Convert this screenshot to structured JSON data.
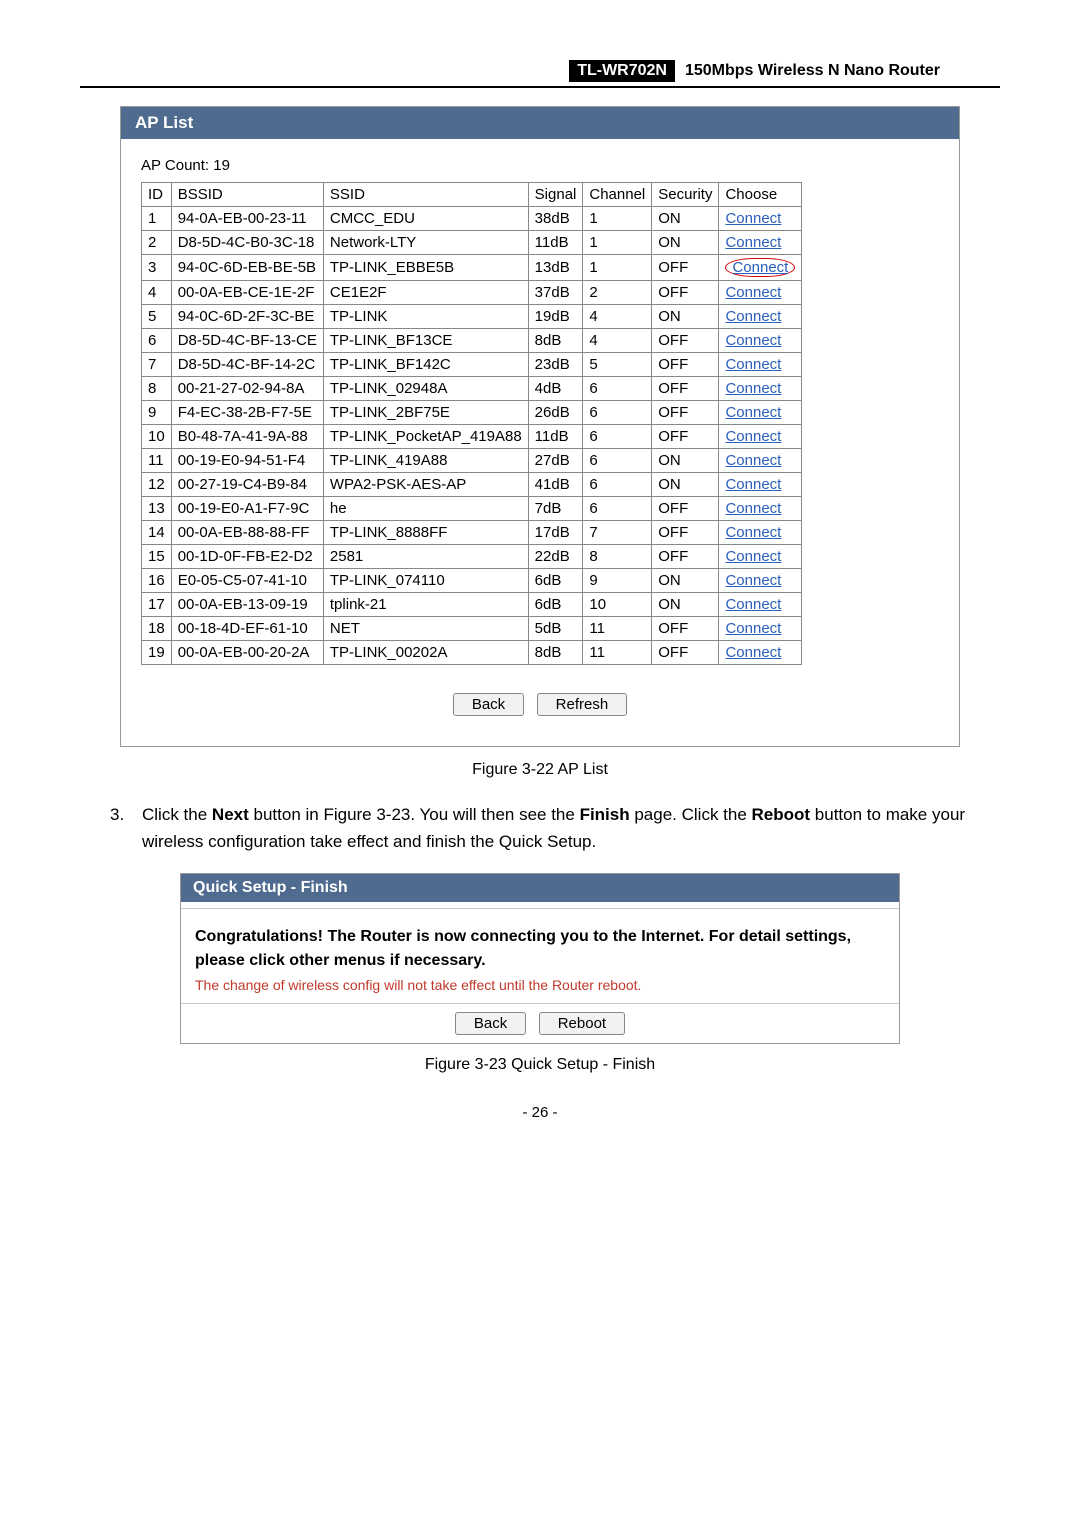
{
  "header": {
    "model": "TL-WR702N",
    "product": "150Mbps Wireless N Nano Router"
  },
  "ap_panel": {
    "title": "AP List",
    "count_label": "AP Count:   19",
    "columns": [
      "ID",
      "BSSID",
      "SSID",
      "Signal",
      "Channel",
      "Security",
      "Choose"
    ],
    "connect_label": "Connect",
    "rows": [
      {
        "id": "1",
        "bssid": "94-0A-EB-00-23-11",
        "ssid": "CMCC_EDU",
        "signal": "38dB",
        "channel": "1",
        "security": "ON",
        "highlight": false
      },
      {
        "id": "2",
        "bssid": "D8-5D-4C-B0-3C-18",
        "ssid": "Network-LTY",
        "signal": "11dB",
        "channel": "1",
        "security": "ON",
        "highlight": false
      },
      {
        "id": "3",
        "bssid": "94-0C-6D-EB-BE-5B",
        "ssid": "TP-LINK_EBBE5B",
        "signal": "13dB",
        "channel": "1",
        "security": "OFF",
        "highlight": true
      },
      {
        "id": "4",
        "bssid": "00-0A-EB-CE-1E-2F",
        "ssid": "CE1E2F",
        "signal": "37dB",
        "channel": "2",
        "security": "OFF",
        "highlight": false
      },
      {
        "id": "5",
        "bssid": "94-0C-6D-2F-3C-BE",
        "ssid": "TP-LINK",
        "signal": "19dB",
        "channel": "4",
        "security": "ON",
        "highlight": false
      },
      {
        "id": "6",
        "bssid": "D8-5D-4C-BF-13-CE",
        "ssid": "TP-LINK_BF13CE",
        "signal": "8dB",
        "channel": "4",
        "security": "OFF",
        "highlight": false
      },
      {
        "id": "7",
        "bssid": "D8-5D-4C-BF-14-2C",
        "ssid": "TP-LINK_BF142C",
        "signal": "23dB",
        "channel": "5",
        "security": "OFF",
        "highlight": false
      },
      {
        "id": "8",
        "bssid": "00-21-27-02-94-8A",
        "ssid": "TP-LINK_02948A",
        "signal": "4dB",
        "channel": "6",
        "security": "OFF",
        "highlight": false
      },
      {
        "id": "9",
        "bssid": "F4-EC-38-2B-F7-5E",
        "ssid": "TP-LINK_2BF75E",
        "signal": "26dB",
        "channel": "6",
        "security": "OFF",
        "highlight": false
      },
      {
        "id": "10",
        "bssid": "B0-48-7A-41-9A-88",
        "ssid": "TP-LINK_PocketAP_419A88",
        "signal": "11dB",
        "channel": "6",
        "security": "OFF",
        "highlight": false
      },
      {
        "id": "11",
        "bssid": "00-19-E0-94-51-F4",
        "ssid": "TP-LINK_419A88",
        "signal": "27dB",
        "channel": "6",
        "security": "ON",
        "highlight": false
      },
      {
        "id": "12",
        "bssid": "00-27-19-C4-B9-84",
        "ssid": "WPA2-PSK-AES-AP",
        "signal": "41dB",
        "channel": "6",
        "security": "ON",
        "highlight": false
      },
      {
        "id": "13",
        "bssid": "00-19-E0-A1-F7-9C",
        "ssid": "he",
        "signal": "7dB",
        "channel": "6",
        "security": "OFF",
        "highlight": false
      },
      {
        "id": "14",
        "bssid": "00-0A-EB-88-88-FF",
        "ssid": "TP-LINK_8888FF",
        "signal": "17dB",
        "channel": "7",
        "security": "OFF",
        "highlight": false
      },
      {
        "id": "15",
        "bssid": "00-1D-0F-FB-E2-D2",
        "ssid": "2581",
        "signal": "22dB",
        "channel": "8",
        "security": "OFF",
        "highlight": false
      },
      {
        "id": "16",
        "bssid": "E0-05-C5-07-41-10",
        "ssid": "TP-LINK_074110",
        "signal": "6dB",
        "channel": "9",
        "security": "ON",
        "highlight": false
      },
      {
        "id": "17",
        "bssid": "00-0A-EB-13-09-19",
        "ssid": "tplink-21",
        "signal": "6dB",
        "channel": "10",
        "security": "ON",
        "highlight": false
      },
      {
        "id": "18",
        "bssid": "00-18-4D-EF-61-10",
        "ssid": "NET",
        "signal": "5dB",
        "channel": "11",
        "security": "OFF",
        "highlight": false
      },
      {
        "id": "19",
        "bssid": "00-0A-EB-00-20-2A",
        "ssid": "TP-LINK_00202A",
        "signal": "8dB",
        "channel": "11",
        "security": "OFF",
        "highlight": false
      }
    ],
    "buttons": {
      "back": "Back",
      "refresh": "Refresh"
    }
  },
  "caption1": "Figure 3-22 AP List",
  "step3": {
    "num": "3.",
    "t1": "Click the ",
    "b1": "Next",
    "t2": " button in Figure 3-23. You will then see the ",
    "b2": "Finish",
    "t3": " page. Click the ",
    "b3": "Reboot",
    "t4": " button to make your wireless configuration take effect and finish the Quick Setup."
  },
  "finish_panel": {
    "title": "Quick Setup - Finish",
    "congrats": "Congratulations! The Router is now connecting you to the Internet. For detail settings, please click other menus if necessary.",
    "warn": "The change of wireless config will not take effect until the Router reboot.",
    "buttons": {
      "back": "Back",
      "reboot": "Reboot"
    }
  },
  "caption2": "Figure 3-23 Quick Setup - Finish",
  "page_num": "- 26 -"
}
